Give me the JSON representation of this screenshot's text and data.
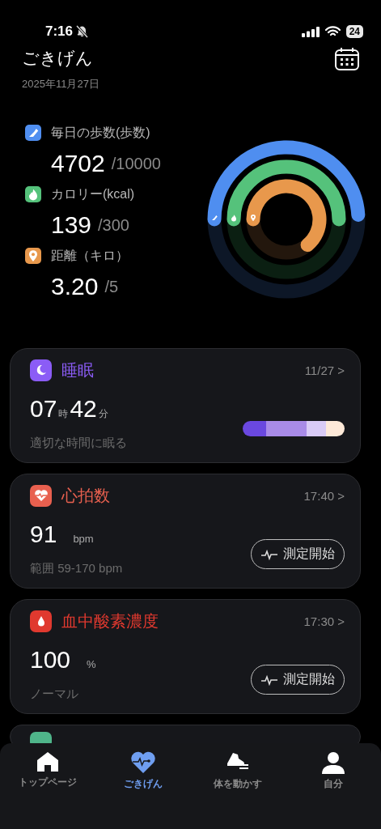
{
  "status_bar": {
    "time": "7:16",
    "battery": "24"
  },
  "header": {
    "title": "ごきげん",
    "date": "2025年11月27日"
  },
  "metrics": [
    {
      "kind": "steps",
      "label": "毎日の歩数(歩数)",
      "value": "4702",
      "goal": "/10000",
      "color": "#4f8ef0"
    },
    {
      "kind": "calories",
      "label": "カロリー(kcal)",
      "value": "139",
      "goal": "/300",
      "color": "#55c27b"
    },
    {
      "kind": "distance",
      "label": "距離（キロ）",
      "value": "3.20",
      "goal": "/5",
      "color": "#e8984c"
    }
  ],
  "cards": [
    {
      "kind": "sleep",
      "title": "睡眠",
      "meta": "11/27 >",
      "color": "#8b5cf6",
      "value_parts": [
        {
          "kind": "num",
          "text": "07"
        },
        {
          "kind": "unit",
          "text": "時"
        },
        {
          "kind": "num",
          "text": "42"
        },
        {
          "kind": "unit",
          "text": "分"
        }
      ],
      "note": "適切な時間に眠る"
    },
    {
      "kind": "heart",
      "title": "心拍数",
      "meta": "17:40 >",
      "color": "#e8604f",
      "value_parts": [
        {
          "kind": "num",
          "text": "91"
        },
        {
          "kind": "unit",
          "text": "bpm"
        }
      ],
      "note": "範囲 59-170 bpm",
      "button": "測定開始"
    },
    {
      "kind": "oxygen",
      "title": "血中酸素濃度",
      "meta": "17:30 >",
      "color": "#e0392f",
      "value_parts": [
        {
          "kind": "num",
          "text": "100"
        },
        {
          "kind": "unit",
          "text": "%"
        }
      ],
      "note": "ノーマル",
      "button": "測定開始"
    },
    {
      "kind": "partial",
      "color": "#4fb58a"
    }
  ],
  "tabs": [
    {
      "kind": "home",
      "label": "トップページ",
      "selected": false
    },
    {
      "kind": "health",
      "label": "ごきげん",
      "selected": true
    },
    {
      "kind": "exercise",
      "label": "体を動かす",
      "selected": false
    },
    {
      "kind": "me",
      "label": "自分",
      "selected": false
    }
  ]
}
